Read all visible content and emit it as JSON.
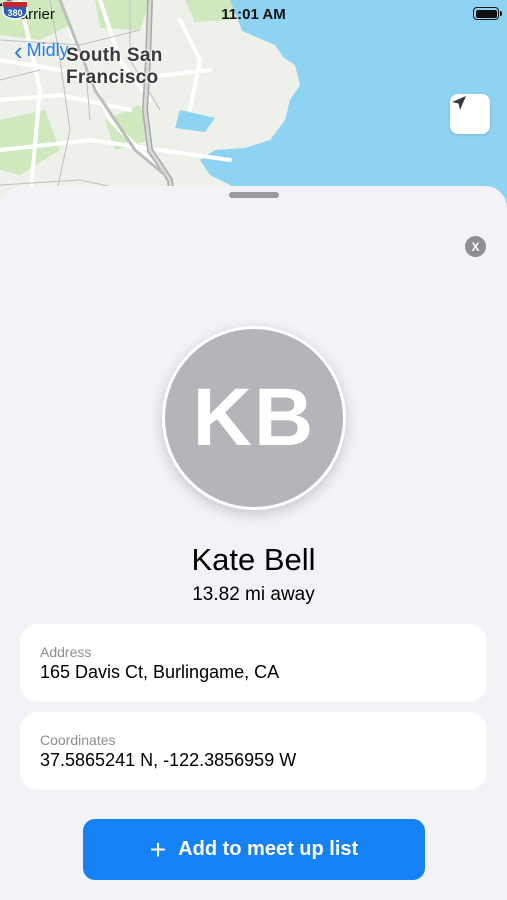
{
  "status_bar": {
    "carrier": "Carrier",
    "time": "11:01 AM"
  },
  "map": {
    "back_label": "Midly",
    "city_line1": "South San",
    "city_line2": "Francisco",
    "highway_shield": "380",
    "water_color": "#8fd3f2"
  },
  "sheet": {
    "initials": "KB",
    "name": "Kate Bell",
    "distance": "13.82 mi away",
    "address_label": "Address",
    "address_value": "165 Davis Ct, Burlingame, CA",
    "coords_label": "Coordinates",
    "coords_value": "37.5865241 N, -122.3856959 W",
    "close_symbol": "X",
    "add_button_label": "Add to meet up list",
    "add_button_icon": "+"
  },
  "colors": {
    "accent": "#1481f5",
    "avatar": "#b4b4b9"
  }
}
